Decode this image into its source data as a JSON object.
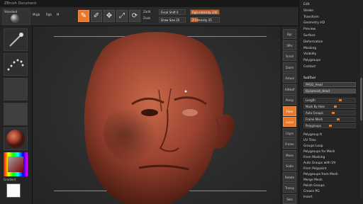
{
  "title": "ZBrush Document",
  "topbar": {
    "brush_label": "Standard",
    "buttons": [
      {
        "label": "Edit",
        "active": true
      },
      {
        "label": "Draw",
        "active": false
      },
      {
        "label": "Move",
        "active": false
      },
      {
        "label": "Scale",
        "active": false
      },
      {
        "label": "Rotate",
        "active": false
      }
    ],
    "mrgb": "Mrgb",
    "rgb": "Rgb",
    "m": "M",
    "zadd": "Zadd",
    "zsub": "Zsub",
    "focal_shift_label": "Focal Shift 0",
    "draw_size_label": "Draw Size 25",
    "rgb_intensity_label": "Rgb Intensity 100",
    "z_intensity_label": "Z Intensity 25",
    "rgb_intensity_value": 1.0,
    "z_intensity_value": 0.25
  },
  "left_shelf": {
    "color_label": "Gradient"
  },
  "right_shelf": [
    "Bpr",
    "SPix",
    "Scroll",
    "Zoom",
    "Actual",
    "AAHalf",
    "Persp",
    "Floor",
    "Local",
    "LSym",
    "Frame",
    "Move",
    "Scale",
    "Rotate",
    "Transp",
    "Solo"
  ],
  "tray": {
    "items": [
      "Edit",
      "Stroke",
      "Transform",
      "Geometry HD",
      "Preview",
      "Surface",
      "Deformation",
      "Masking",
      "Visibility",
      "Polygroups",
      "Contact"
    ],
    "subtool_label": "SubTool",
    "list_name": "PM3D_Head",
    "list_selected": "Dynamesh_Head",
    "sliders": [
      {
        "label": "Length",
        "value": 0.7
      },
      {
        "label": "Mask By Hole",
        "value": 0.6
      },
      {
        "label": "Auto Groups",
        "value": 0.55
      },
      {
        "label": "Frame Mesh",
        "value": 0.65
      },
      {
        "label": "Polygroups",
        "value": 0.5
      }
    ],
    "lower_items": [
      "Polygroup It",
      "UV Tiles",
      "Groups Loop",
      "Polygroups for Mesh",
      "From Masking",
      "Auto Groups with UV",
      "From Polypaint",
      "Polygroups from Mesh",
      "Merge Mesh",
      "Polish Groups",
      "Crease PG",
      "Insert"
    ]
  }
}
